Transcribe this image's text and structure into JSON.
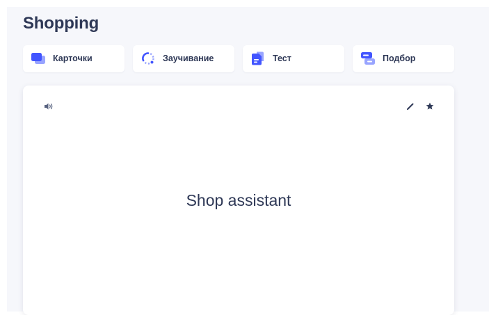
{
  "set": {
    "title": "Shopping"
  },
  "study_modes": [
    {
      "label": "Карточки",
      "icon": "flashcards-icon"
    },
    {
      "label": "Заучивание",
      "icon": "learn-progress-icon"
    },
    {
      "label": "Тест",
      "icon": "test-document-icon"
    },
    {
      "label": "Подбор",
      "icon": "match-icon"
    }
  ],
  "flashcard": {
    "term": "Shop assistant",
    "audio_icon": "speaker-icon",
    "edit_icon": "pencil-icon",
    "star_icon": "star-icon"
  },
  "colors": {
    "accent": "#4255ff",
    "accent_light": "#98a4ff",
    "text": "#2e3856",
    "page_background": "#f6f7fb"
  }
}
